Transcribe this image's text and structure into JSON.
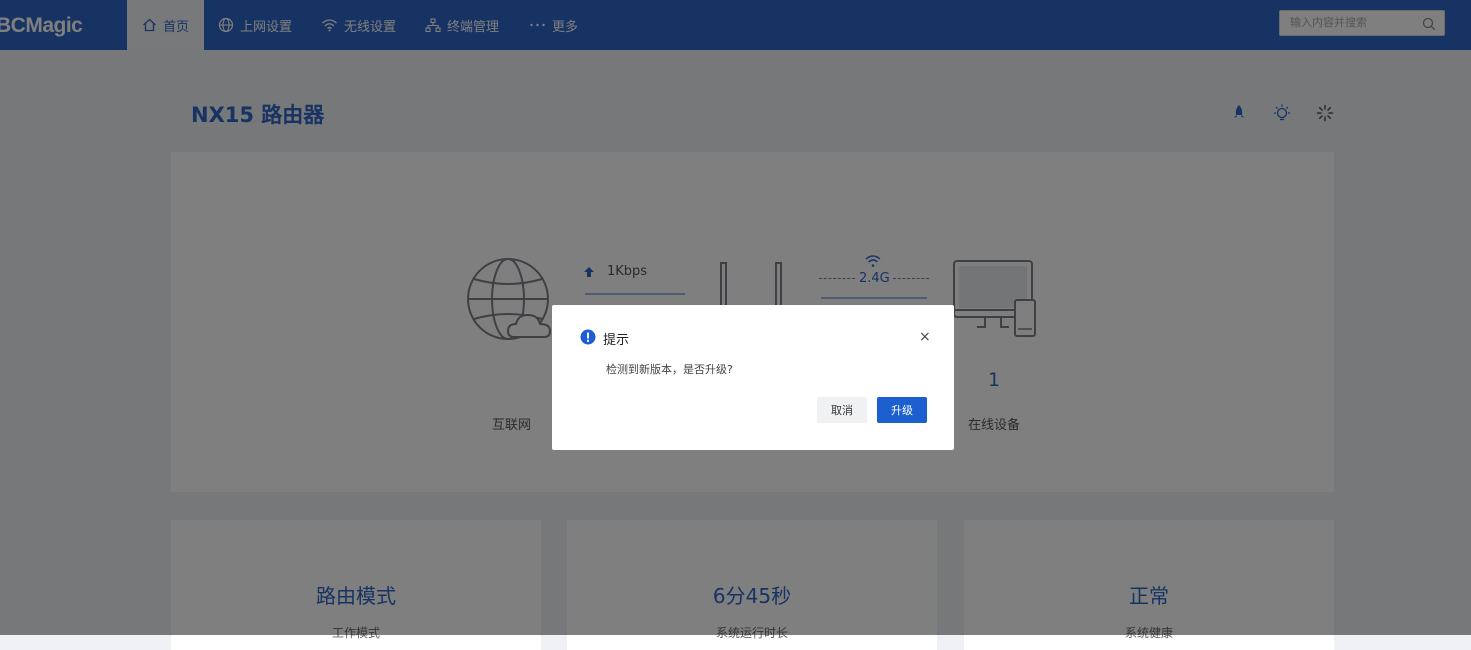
{
  "brand": {
    "logo_text": "BCMagic"
  },
  "nav": {
    "items": [
      {
        "label": "首页",
        "icon": "home-icon",
        "active": true
      },
      {
        "label": "上网设置",
        "icon": "globe-icon"
      },
      {
        "label": "无线设置",
        "icon": "wifi-icon"
      },
      {
        "label": "终端管理",
        "icon": "network-icon"
      },
      {
        "label": "更多",
        "icon": "more-icon"
      }
    ]
  },
  "search": {
    "placeholder": "输入内容并搜索"
  },
  "page": {
    "title": "NX15 路由器"
  },
  "topology": {
    "internet_label": "互联网",
    "upload_rate": "1Kbps",
    "band": "2.4G",
    "online_count": "1",
    "online_label": "在线设备"
  },
  "cards": [
    {
      "value": "路由模式",
      "label": "工作模式"
    },
    {
      "value": "6分45秒",
      "label": "系统运行时长"
    },
    {
      "value": "正常",
      "label": "系统健康"
    }
  ],
  "dialog": {
    "title": "提示",
    "message": "检测到新版本，是否升级?",
    "cancel_label": "取消",
    "ok_label": "升级",
    "close_glyph": "×"
  },
  "colors": {
    "brand": "#2f66c6",
    "primary_button": "#1c5fcf"
  }
}
